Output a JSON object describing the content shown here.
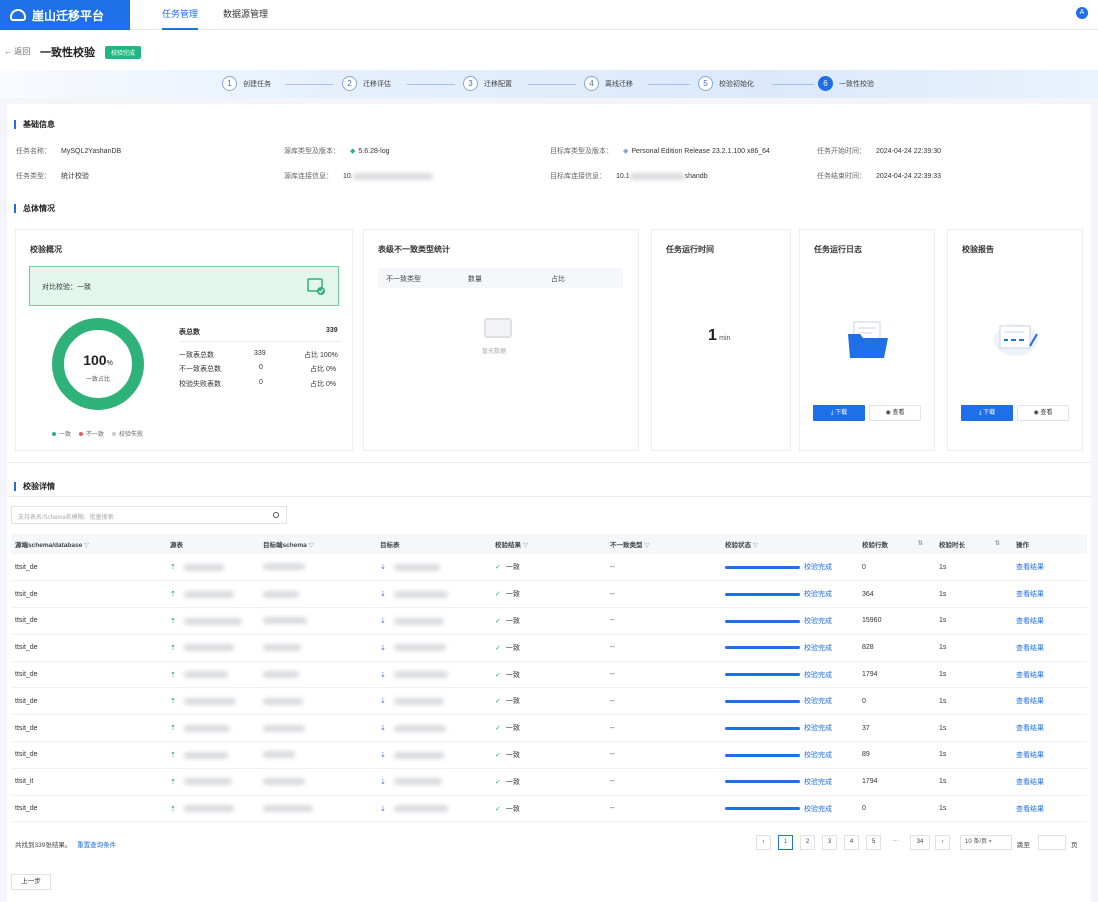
{
  "app": {
    "brand": "崖山迁移平台",
    "avatar": "A"
  },
  "nav": {
    "tabs": [
      "任务管理",
      "数据源管理"
    ]
  },
  "header": {
    "back": "返回",
    "title": "一致性校验",
    "badge": "校验完成"
  },
  "steps": [
    {
      "num": "1",
      "label": "创建任务"
    },
    {
      "num": "2",
      "label": "迁移评估"
    },
    {
      "num": "3",
      "label": "迁移配置"
    },
    {
      "num": "4",
      "label": "离线迁移"
    },
    {
      "num": "5",
      "label": "校验初始化"
    },
    {
      "num": "6",
      "label": "一致性校验"
    }
  ],
  "basic": {
    "title": "基础信息",
    "task_name_k": "任务名称：",
    "task_name_v": "MySQL2YashanDB",
    "task_type_k": "任务类型：",
    "task_type_v": "统计校验",
    "src_type_k": "源库类型及版本：",
    "src_type_v": "5.6.28-log",
    "src_conn_k": "源库连接信息：",
    "src_conn_v": "10.",
    "tgt_type_k": "目标库类型及版本：",
    "tgt_type_v": "Personal Edition Release 23.2.1.100 x86_64",
    "tgt_conn_k": "目标库连接信息：",
    "tgt_conn_v": "10.1",
    "tgt_conn_suffix": "shandb",
    "start_k": "任务开始时间：",
    "start_v": "2024-04-24 22:39:30",
    "end_k": "任务结束时间：",
    "end_v": "2024-04-24 22:39:33"
  },
  "overall": {
    "title": "总体情况",
    "summary": {
      "title": "校验概况",
      "banner": "对比校验：一致",
      "percent": 100,
      "percent_text": "100",
      "percent_unit": "%",
      "donut_label": "一致占比",
      "total_label": "表总数",
      "total_value": "339",
      "rows": [
        {
          "label": "一致表总数",
          "value": "339",
          "ratio": "占比 100%"
        },
        {
          "label": "不一致表总数",
          "value": "0",
          "ratio": "占比 0%"
        },
        {
          "label": "校验失败表数",
          "value": "0",
          "ratio": "占比 0%"
        }
      ],
      "legend": [
        "一致",
        "不一致",
        "校验失败"
      ]
    },
    "mismatch": {
      "title": "表级不一致类型统计",
      "cols": [
        "不一致类型",
        "数量",
        "占比"
      ],
      "empty": "暂无数据"
    },
    "runtime": {
      "title": "任务运行时间",
      "value": "1",
      "unit": "min"
    },
    "log": {
      "title": "任务运行日志",
      "download": "下载",
      "view": "查看"
    },
    "report": {
      "title": "校验报告",
      "download": "下载",
      "view": "查看"
    }
  },
  "details": {
    "title": "校验详情",
    "search_placeholder": "支持表名/Schema名模糊、批量搜索",
    "columns": [
      "源端schema/database",
      "源表",
      "目标端schema",
      "目标表",
      "校验结果",
      "不一致类型",
      "校验状态",
      "校验行数",
      "校验时长",
      "操作"
    ],
    "rows": [
      {
        "schema": "ttsit_de",
        "result": "一致",
        "type": "--",
        "status": "校验完成",
        "count": "0",
        "duration": "1s",
        "action": "查看结果"
      },
      {
        "schema": "ttsit_de",
        "result": "一致",
        "type": "--",
        "status": "校验完成",
        "count": "364",
        "duration": "1s",
        "action": "查看结果"
      },
      {
        "schema": "ttsit_de",
        "result": "一致",
        "type": "--",
        "status": "校验完成",
        "count": "15960",
        "duration": "1s",
        "action": "查看结果"
      },
      {
        "schema": "ttsit_de",
        "result": "一致",
        "type": "--",
        "status": "校验完成",
        "count": "828",
        "duration": "1s",
        "action": "查看结果"
      },
      {
        "schema": "ttsit_de",
        "result": "一致",
        "type": "--",
        "status": "校验完成",
        "count": "1794",
        "duration": "1s",
        "action": "查看结果"
      },
      {
        "schema": "ttsit_de",
        "result": "一致",
        "type": "--",
        "status": "校验完成",
        "count": "0",
        "duration": "1s",
        "action": "查看结果"
      },
      {
        "schema": "ttsit_de",
        "result": "一致",
        "type": "--",
        "status": "校验完成",
        "count": "37",
        "duration": "1s",
        "action": "查看结果"
      },
      {
        "schema": "ttsit_de",
        "result": "一致",
        "type": "--",
        "status": "校验完成",
        "count": "89",
        "duration": "1s",
        "action": "查看结果"
      },
      {
        "schema": "ttsit_it",
        "result": "一致",
        "type": "--",
        "status": "校验完成",
        "count": "1794",
        "duration": "1s",
        "action": "查看结果"
      },
      {
        "schema": "ttsit_de",
        "result": "一致",
        "type": "--",
        "status": "校验完成",
        "count": "0",
        "duration": "1s",
        "action": "查看结果"
      }
    ],
    "footer_text": "共找到339张结果。",
    "reset_link": "重置查询条件",
    "pages": [
      "1",
      "2",
      "3",
      "4",
      "5",
      "···",
      "34"
    ],
    "page_size": "10 条/页",
    "goto_label": "跳至",
    "goto_unit": "页"
  },
  "prev_step": "上一步",
  "colors": {
    "accent": "#1f6fe8",
    "success": "#2fb27a"
  }
}
